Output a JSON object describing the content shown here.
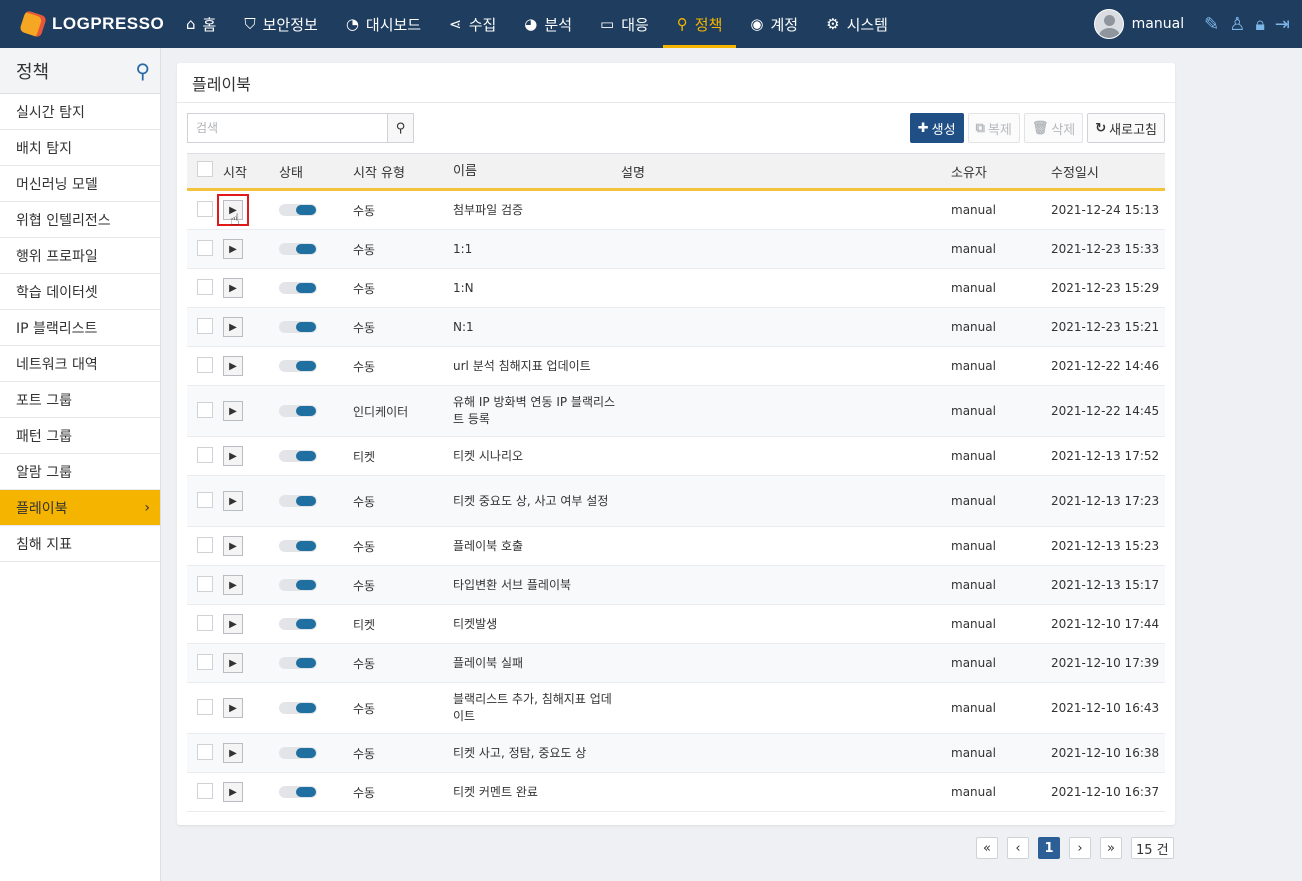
{
  "brand": {
    "name": "LOGPRESSO"
  },
  "nav": [
    {
      "icon": "⌂",
      "label": "홈",
      "active": false
    },
    {
      "icon": "⛉",
      "label": "보안정보",
      "active": false
    },
    {
      "icon": "◔",
      "label": "대시보드",
      "active": false
    },
    {
      "icon": "⋖",
      "label": "수집",
      "active": false
    },
    {
      "icon": "◕",
      "label": "분석",
      "active": false
    },
    {
      "icon": "▭",
      "label": "대응",
      "active": false
    },
    {
      "icon": "⚲",
      "label": "정책",
      "active": true
    },
    {
      "icon": "◉",
      "label": "계정",
      "active": false
    },
    {
      "icon": "⚙",
      "label": "시스템",
      "active": false
    }
  ],
  "user": {
    "name": "manual"
  },
  "sidebar": {
    "title": "정책",
    "items": [
      {
        "label": "실시간 탐지"
      },
      {
        "label": "배치 탐지"
      },
      {
        "label": "머신러닝 모델"
      },
      {
        "label": "위협 인텔리전스"
      },
      {
        "label": "행위 프로파일"
      },
      {
        "label": "학습 데이터셋"
      },
      {
        "label": "IP 블랙리스트"
      },
      {
        "label": "네트워크 대역"
      },
      {
        "label": "포트 그룹"
      },
      {
        "label": "패턴 그룹"
      },
      {
        "label": "알람 그룹"
      },
      {
        "label": "플레이북",
        "active": true,
        "arrow": "›"
      },
      {
        "label": "침해 지표"
      }
    ]
  },
  "panel": {
    "title": "플레이북"
  },
  "search": {
    "placeholder": "검색",
    "value": ""
  },
  "buttons": {
    "create": "생성",
    "copy": "복제",
    "delete": "삭제",
    "refresh": "새로고침"
  },
  "table": {
    "columns": [
      "시작",
      "상태",
      "시작 유형",
      "이름",
      "설명",
      "소유자",
      "수정일시"
    ],
    "rows": [
      {
        "type": "수동",
        "name": "첨부파일 검증",
        "desc": "",
        "owner": "manual",
        "date": "2021-12-24 15:13",
        "enabled": true
      },
      {
        "type": "수동",
        "name": "1:1",
        "desc": "",
        "owner": "manual",
        "date": "2021-12-23 15:33",
        "enabled": true
      },
      {
        "type": "수동",
        "name": "1:N",
        "desc": "",
        "owner": "manual",
        "date": "2021-12-23 15:29",
        "enabled": true
      },
      {
        "type": "수동",
        "name": "N:1",
        "desc": "",
        "owner": "manual",
        "date": "2021-12-23 15:21",
        "enabled": true
      },
      {
        "type": "수동",
        "name": "url 분석 침해지표 업데이트",
        "desc": "",
        "owner": "manual",
        "date": "2021-12-22 14:46",
        "enabled": true
      },
      {
        "type": "인디케이터",
        "name": "유해 IP 방화벽 연동 IP 블랙리스트 등록",
        "desc": "",
        "owner": "manual",
        "date": "2021-12-22 14:45",
        "enabled": true
      },
      {
        "type": "티켓",
        "name": "티켓 시나리오",
        "desc": "",
        "owner": "manual",
        "date": "2021-12-13 17:52",
        "enabled": true
      },
      {
        "type": "수동",
        "name": "티켓 중요도 상, 사고 여부 설정",
        "desc": "",
        "owner": "manual",
        "date": "2021-12-13 17:23",
        "enabled": true
      },
      {
        "type": "수동",
        "name": "플레이북 호출",
        "desc": "",
        "owner": "manual",
        "date": "2021-12-13 15:23",
        "enabled": true
      },
      {
        "type": "수동",
        "name": "타입변환 서브 플레이북",
        "desc": "",
        "owner": "manual",
        "date": "2021-12-13 15:17",
        "enabled": true
      },
      {
        "type": "티켓",
        "name": "티켓발생",
        "desc": "",
        "owner": "manual",
        "date": "2021-12-10 17:44",
        "enabled": true
      },
      {
        "type": "수동",
        "name": "플레이북 실패",
        "desc": "",
        "owner": "manual",
        "date": "2021-12-10 17:39",
        "enabled": true
      },
      {
        "type": "수동",
        "name": "블랙리스트 추가, 침해지표 업데이트",
        "desc": "",
        "owner": "manual",
        "date": "2021-12-10 16:43",
        "enabled": true
      },
      {
        "type": "수동",
        "name": "티켓 사고, 정탐, 중요도 상",
        "desc": "",
        "owner": "manual",
        "date": "2021-12-10 16:38",
        "enabled": true
      },
      {
        "type": "수동",
        "name": "티켓 커멘트 완료",
        "desc": "",
        "owner": "manual",
        "date": "2021-12-10 16:37",
        "enabled": true
      }
    ]
  },
  "pagination": {
    "first": "«",
    "prev": "‹",
    "current": "1",
    "next": "›",
    "last": "»",
    "total": "15 건"
  }
}
